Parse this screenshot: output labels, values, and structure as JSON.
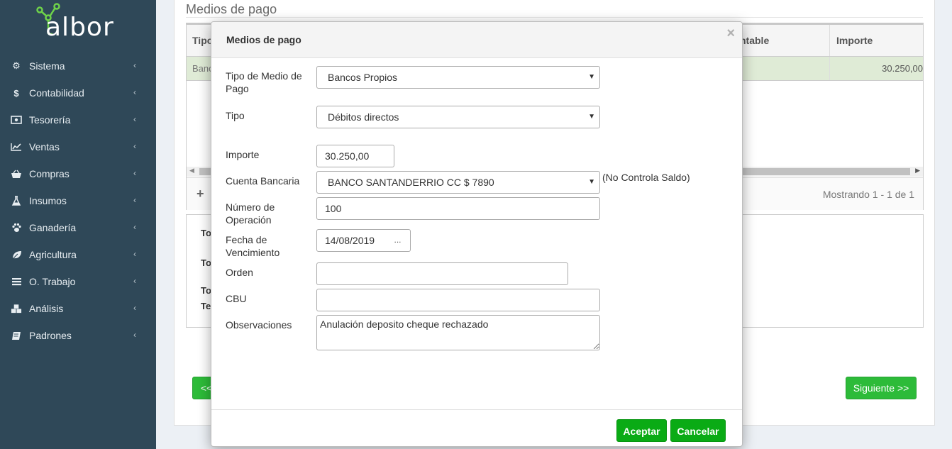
{
  "app": {
    "logo_text": "albor"
  },
  "sidebar": {
    "items": [
      {
        "label": "Sistema",
        "icon": "gears-icon"
      },
      {
        "label": "Contabilidad",
        "icon": "dollar-icon"
      },
      {
        "label": "Tesorería",
        "icon": "money-bill-icon"
      },
      {
        "label": "Ventas",
        "icon": "line-chart-icon"
      },
      {
        "label": "Compras",
        "icon": "basket-icon"
      },
      {
        "label": "Insumos",
        "icon": "flask-icon"
      },
      {
        "label": "Ganadería",
        "icon": "paw-icon"
      },
      {
        "label": "Agricultura",
        "icon": "leaf-icon"
      },
      {
        "label": "O. Trabajo",
        "icon": "list-icon"
      },
      {
        "label": "Análisis",
        "icon": "cubes-icon"
      },
      {
        "label": "Padrones",
        "icon": "book-icon"
      }
    ]
  },
  "background": {
    "panel_title": "Medios de pago",
    "table": {
      "col_tipo": "Tipo",
      "col_contable": "ntable",
      "col_importe": "Importe",
      "row_tipo": "Banc",
      "row_importe": "30.250,00",
      "add_symbol": "+",
      "showing_text": "Mostrando 1 - 1 de 1"
    },
    "totals": {
      "lbl1": "To",
      "lbl2": "To",
      "lbl3": "To",
      "lbl4": "Te"
    },
    "prev_button": "<<",
    "next_button": "Siguiente >>"
  },
  "modal": {
    "title": "Medios de pago",
    "close_symbol": "×",
    "fields": {
      "tipo_medio_label": "Tipo de Medio de Pago",
      "tipo_medio_value": "Bancos Propios",
      "tipo_label": "Tipo",
      "tipo_value": "Débitos directos",
      "importe_label": "Importe",
      "importe_value": "30.250,00",
      "cuenta_label": "Cuenta Bancaria",
      "cuenta_value": "BANCO SANTANDERRIO CC $ 7890",
      "cuenta_note": "(No Controla Saldo)",
      "numero_label": "Número de Operación",
      "numero_value": "100",
      "fecha_label": "Fecha de Vencimiento",
      "fecha_value": "14/08/2019",
      "fecha_btn": "...",
      "orden_label": "Orden",
      "orden_value": "",
      "cbu_label": "CBU",
      "cbu_value": "",
      "obs_label": "Observaciones",
      "obs_value": "Anulación deposito cheque rechazado"
    },
    "accept_button": "Aceptar",
    "cancel_button": "Cancelar"
  },
  "colors": {
    "sidebar_bg": "#2f4858",
    "accent_green": "#0aab15",
    "logo_green": "#6fd34a",
    "row_highlight": "#dfebd6"
  }
}
